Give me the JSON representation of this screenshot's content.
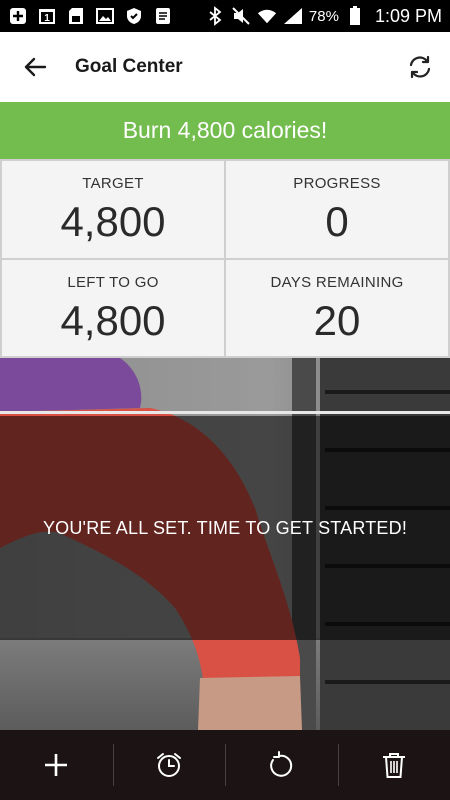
{
  "status_bar": {
    "battery": "78%",
    "time": "1:09 PM"
  },
  "header": {
    "title": "Goal Center",
    "back_icon": "arrow-left-icon",
    "refresh_icon": "refresh-icon"
  },
  "goal": {
    "banner": "Burn 4,800 calories!"
  },
  "stats": [
    {
      "label": "TARGET",
      "value": "4,800"
    },
    {
      "label": "PROGRESS",
      "value": "0"
    },
    {
      "label": "LEFT TO GO",
      "value": "4,800"
    },
    {
      "label": "DAYS REMAINING",
      "value": "20"
    }
  ],
  "message": "YOU'RE ALL SET. TIME TO GET STARTED!",
  "toolbar": {
    "icons": [
      "plus-icon",
      "alarm-clock-icon",
      "reset-icon",
      "trash-icon"
    ]
  },
  "colors": {
    "accent": "#73bd4f",
    "toolbar_bg": "#1c1414"
  }
}
